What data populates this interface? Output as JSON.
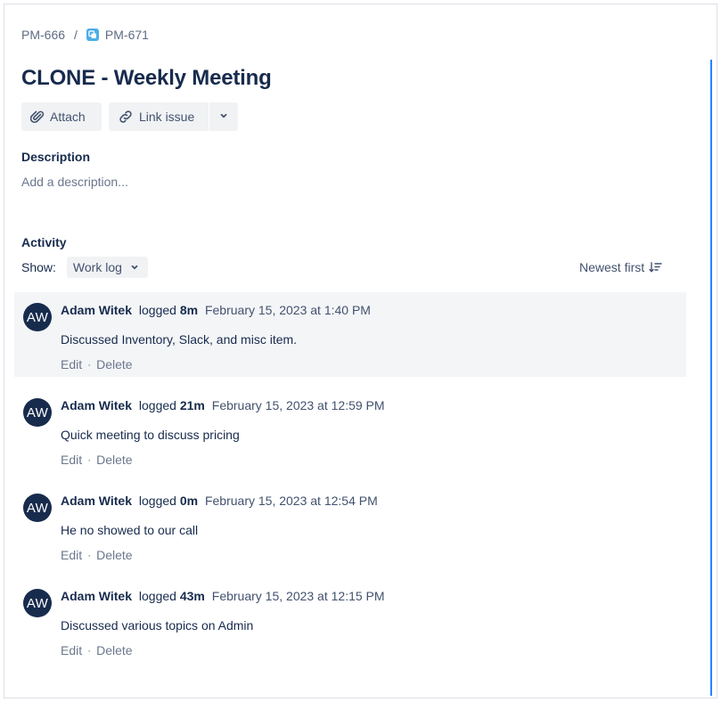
{
  "breadcrumb": {
    "parent": "PM-666",
    "separator": "/",
    "current": "PM-671"
  },
  "issue": {
    "title": "CLONE - Weekly Meeting"
  },
  "toolbar": {
    "attach_label": "Attach",
    "link_label": "Link issue"
  },
  "description": {
    "label": "Description",
    "placeholder": "Add a description..."
  },
  "activity": {
    "label": "Activity",
    "show_label": "Show:",
    "show_value": "Work log",
    "sort_label": "Newest first"
  },
  "entries": [
    {
      "initials": "AW",
      "author": "Adam Witek",
      "logged": "logged",
      "duration": "8m",
      "date": "February 15, 2023 at 1:40 PM",
      "comment": "Discussed Inventory, Slack, and misc item.",
      "edit": "Edit",
      "delete": "Delete",
      "highlighted": true
    },
    {
      "initials": "AW",
      "author": "Adam Witek",
      "logged": "logged",
      "duration": "21m",
      "date": "February 15, 2023 at 12:59 PM",
      "comment": "Quick meeting to discuss pricing",
      "edit": "Edit",
      "delete": "Delete",
      "highlighted": false
    },
    {
      "initials": "AW",
      "author": "Adam Witek",
      "logged": "logged",
      "duration": "0m",
      "date": "February 15, 2023 at 12:54 PM",
      "comment": "He no showed to our call",
      "edit": "Edit",
      "delete": "Delete",
      "highlighted": false
    },
    {
      "initials": "AW",
      "author": "Adam Witek",
      "logged": "logged",
      "duration": "43m",
      "date": "February 15, 2023 at 12:15 PM",
      "comment": "Discussed various topics on Admin",
      "edit": "Edit",
      "delete": "Delete",
      "highlighted": false
    }
  ],
  "icons": {
    "issue_type": "task-clone-icon",
    "attach": "paperclip-icon",
    "link": "link-icon",
    "more": "chevron-down-icon",
    "show": "chevron-down-icon",
    "sort": "sort-descending-icon"
  },
  "colors": {
    "accent": "#2684ff",
    "avatar_bg": "#172b4d",
    "highlight_bg": "#f4f5f7",
    "issue_type": "#4bade8"
  }
}
